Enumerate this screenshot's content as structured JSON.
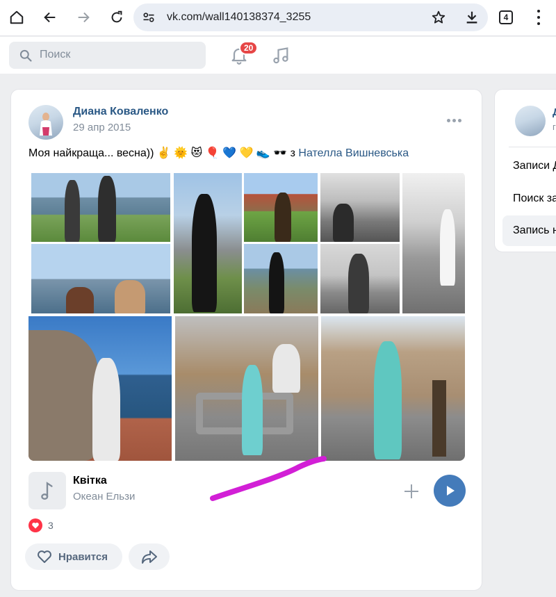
{
  "browser": {
    "url": "vk.com/wall140138374_3255",
    "tab_count": "4"
  },
  "vk_header": {
    "search_placeholder": "Поиск",
    "notifications_count": "20"
  },
  "post": {
    "author": "Диана Коваленко",
    "date": "29 апр 2015",
    "text_prefix": "Моя найкраща... весна))",
    "emojis": "✌️ 🌞 😻 🎈 💙 💛 👟 🕶️",
    "with_word": "з",
    "tagged_person": "Нателла Вишневська",
    "audio": {
      "title": "Квітка",
      "artist": "Океан Ельзи"
    },
    "likes_count": "3",
    "like_label": "Нравится"
  },
  "sidebar": {
    "name_initial": "Д",
    "sub_initial": "г",
    "items": [
      "Записи Д",
      "Поиск за",
      "Запись н"
    ]
  },
  "colors": {
    "link": "#2a5885",
    "accent_blue": "#447bba",
    "badge_red": "#e64646",
    "scribble": "#d21fd6"
  }
}
